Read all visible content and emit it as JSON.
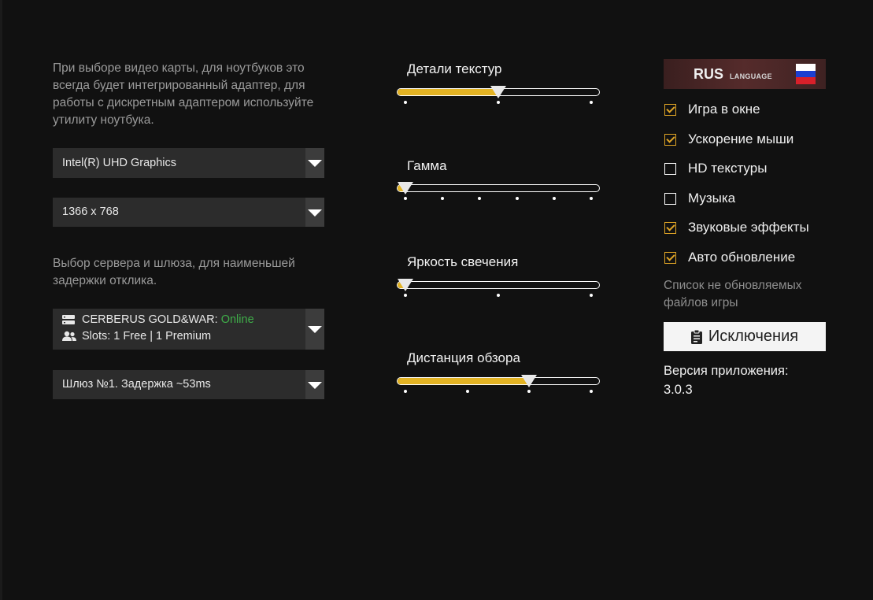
{
  "gpu_note": "При выборе видео карты, для ноутбуков это всегда будет интегрированный адаптер, для работы с дискретным адаптером используйте утилиту ноутбука.",
  "gpu_select": {
    "value": "Intel(R) UHD Graphics"
  },
  "resolution_select": {
    "value": "1366 x 768"
  },
  "server_note": "Выбор сервера и шлюза, для наименьшей задержки отклика.",
  "server_select": {
    "name": "CERBERUS GOLD&WAR:",
    "status": "Online",
    "slots": "Slots: 1 Free | 1 Premium",
    "server_icon": "server-icon",
    "users_icon": "users-icon"
  },
  "gateway_select": {
    "value": "Шлюз №1. Задержка ~53ms"
  },
  "sliders": [
    {
      "label": "Детали текстур",
      "value": 0.5,
      "steps": 3
    },
    {
      "label": "Гамма",
      "value": 0,
      "steps": 6
    },
    {
      "label": "Яркость свечения",
      "value": 0,
      "steps": 3
    },
    {
      "label": "Дистанция обзора",
      "value": 0.667,
      "steps": 4
    }
  ],
  "language_button": {
    "code": "RUS",
    "word": "LANGUAGE",
    "flag_icon": "russia-flag-icon"
  },
  "options": [
    {
      "label": "Игра в окне",
      "checked": true
    },
    {
      "label": "Ускорение мыши",
      "checked": true
    },
    {
      "label": "HD текстуры",
      "checked": false
    },
    {
      "label": "Музыка",
      "checked": false
    },
    {
      "label": "Звуковые эффекты",
      "checked": true
    },
    {
      "label": "Авто обновление",
      "checked": true
    }
  ],
  "exclusions_note": "Список не обновляемых файлов игры",
  "exclusions_button": {
    "label": "Исключения",
    "icon": "clipboard-icon"
  },
  "version_label": "Версия приложения:",
  "version_value": "3.0.3",
  "colors": {
    "accent": "#e3b323",
    "online": "#3fae49",
    "background": "#111111",
    "select_bg": "#2c2c2c"
  }
}
